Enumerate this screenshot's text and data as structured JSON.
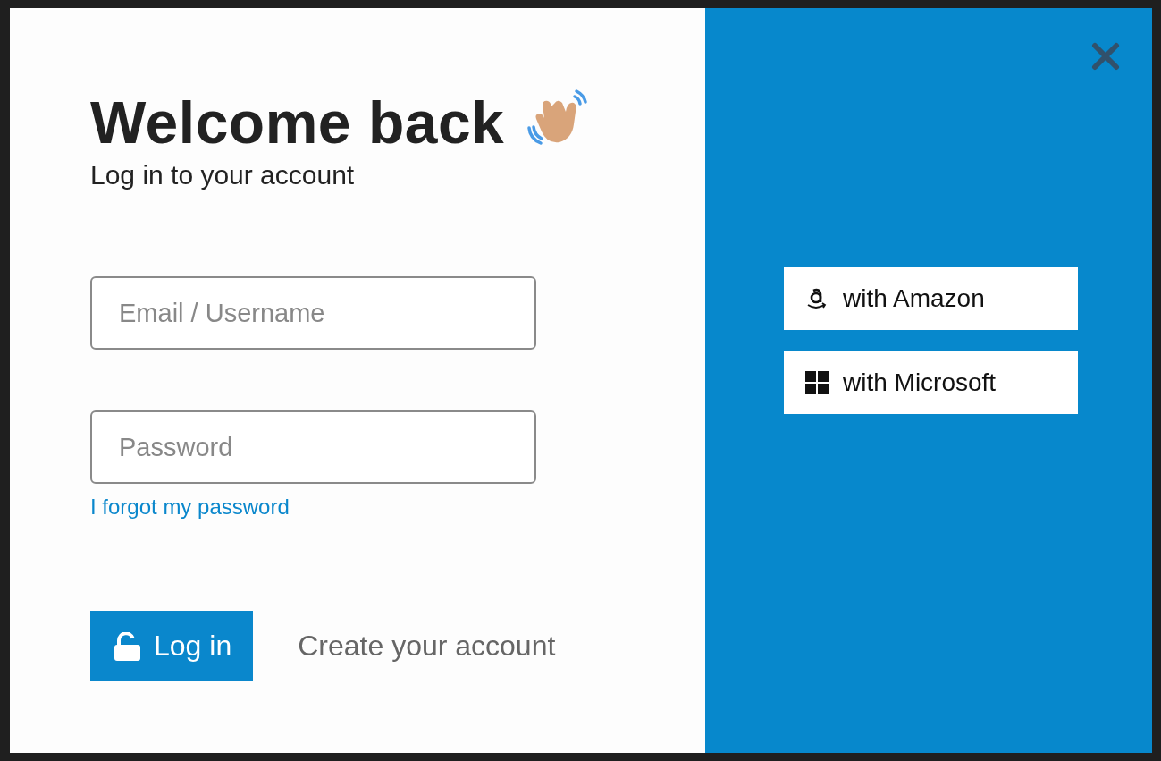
{
  "login": {
    "title": "Welcome back",
    "subtitle": "Log in to your account",
    "fields": [
      {
        "placeholder": "Email / Username"
      },
      {
        "placeholder": "Password"
      }
    ],
    "forgot_link": "I forgot my password",
    "login_button": "Log in",
    "create_link": "Create your account"
  },
  "providers": [
    {
      "kind": "amazon",
      "label": "with Amazon"
    },
    {
      "kind": "microsoft",
      "label": "with Microsoft"
    }
  ]
}
